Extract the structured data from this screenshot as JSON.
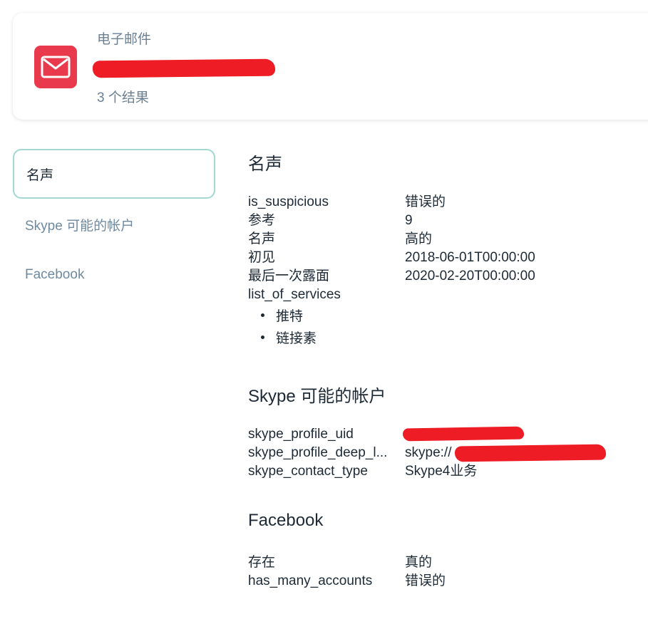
{
  "header": {
    "kind_label": "电子邮件",
    "email_value": "",
    "result_count": "3 个结果"
  },
  "sidebar": {
    "items": [
      {
        "label": "名声",
        "active": true
      },
      {
        "label": "Skype 可能的帐户",
        "active": false
      },
      {
        "label": "Facebook",
        "active": false
      }
    ]
  },
  "sections": {
    "reputation": {
      "title": "名声",
      "rows": [
        {
          "key": "is_suspicious",
          "value": "错误的"
        },
        {
          "key": "参考",
          "value": "9"
        },
        {
          "key": "名声",
          "value": "高的"
        },
        {
          "key": "初见",
          "value": "2018-06-01T00:00:00"
        },
        {
          "key": "最后一次露面",
          "value": "2020-02-20T00:00:00"
        },
        {
          "key": "list_of_services",
          "value": ""
        }
      ],
      "services": [
        "推特",
        "链接素"
      ]
    },
    "skype": {
      "title": "Skype 可能的帐户",
      "rows": [
        {
          "key": "skype_profile_uid",
          "value": ""
        },
        {
          "key": "skype_profile_deep_l...",
          "value": "skype://"
        },
        {
          "key": "skype_contact_type",
          "value": "Skype4业务"
        }
      ]
    },
    "facebook": {
      "title": "Facebook",
      "rows": [
        {
          "key": "存在",
          "value": "真的"
        },
        {
          "key": "has_many_accounts",
          "value": "错误的"
        }
      ]
    }
  },
  "colors": {
    "mail_tile": "#e8394d",
    "active_border": "#a3d7d5",
    "muted_text": "#6b7f93",
    "main_text": "#1d2a36",
    "redaction": "#ee1c25"
  },
  "icons": {
    "header": "mail-icon"
  }
}
